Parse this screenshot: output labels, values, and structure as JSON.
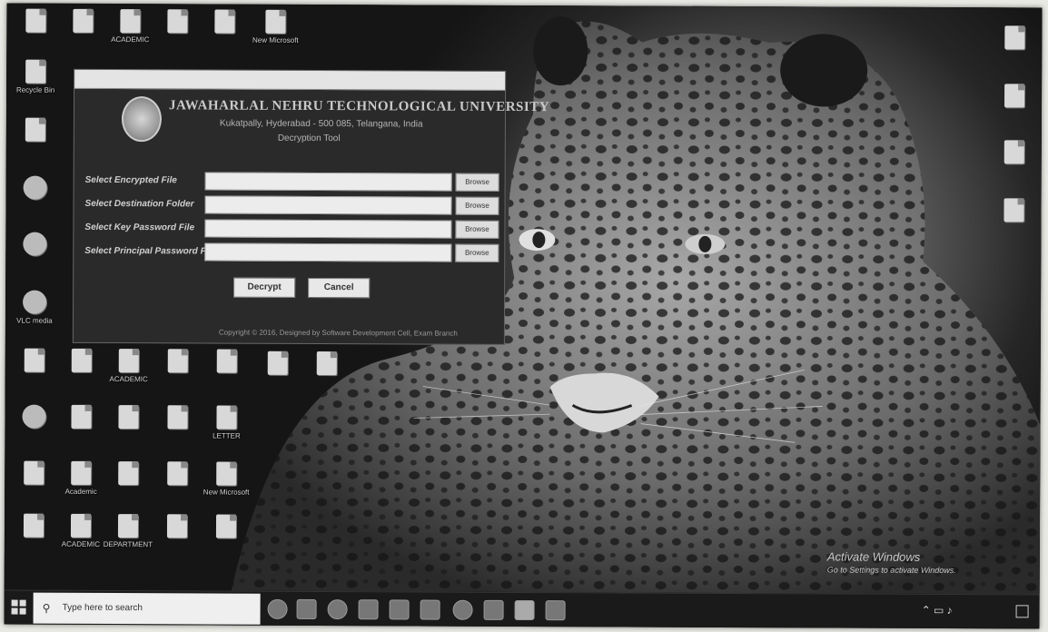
{
  "desktop": {
    "icons": [
      {
        "id": "i1",
        "label": "",
        "shape": "doc"
      },
      {
        "id": "i2",
        "label": "",
        "shape": "doc"
      },
      {
        "id": "i3",
        "label": "ACADEMIC",
        "shape": "doc"
      },
      {
        "id": "i4",
        "label": "",
        "shape": "doc"
      },
      {
        "id": "i5",
        "label": "",
        "shape": "doc"
      },
      {
        "id": "i6",
        "label": "New Microsoft",
        "shape": "doc"
      },
      {
        "id": "i7",
        "label": "Recycle Bin",
        "shape": "doc"
      },
      {
        "id": "i8",
        "label": "",
        "shape": "doc"
      },
      {
        "id": "i9",
        "label": "",
        "shape": "round"
      },
      {
        "id": "i10",
        "label": "",
        "shape": "round"
      },
      {
        "id": "i11",
        "label": "VLC media",
        "shape": "round"
      },
      {
        "id": "i12",
        "label": "",
        "shape": "doc"
      },
      {
        "id": "i13",
        "label": "ACADEMIC",
        "shape": "doc"
      },
      {
        "id": "i14",
        "label": "",
        "shape": "doc"
      },
      {
        "id": "i15",
        "label": "",
        "shape": "doc"
      },
      {
        "id": "i16",
        "label": "",
        "shape": "doc"
      },
      {
        "id": "i17",
        "label": "LETTER",
        "shape": "doc"
      },
      {
        "id": "i18",
        "label": "",
        "shape": "doc"
      },
      {
        "id": "i19",
        "label": "Academic",
        "shape": "doc"
      },
      {
        "id": "i20",
        "label": "",
        "shape": "doc"
      },
      {
        "id": "i21",
        "label": "",
        "shape": "doc"
      },
      {
        "id": "i22",
        "label": "New Microsoft",
        "shape": "doc"
      },
      {
        "id": "i23",
        "label": "",
        "shape": "doc"
      },
      {
        "id": "i24",
        "label": "ACADEMIC",
        "shape": "doc"
      },
      {
        "id": "i25",
        "label": "DEPARTMENT",
        "shape": "doc"
      },
      {
        "id": "i26",
        "label": "",
        "shape": "doc"
      },
      {
        "id": "i27",
        "label": "",
        "shape": "doc"
      },
      {
        "id": "i28",
        "label": "",
        "shape": "doc"
      },
      {
        "id": "i29",
        "label": "",
        "shape": "doc"
      },
      {
        "id": "i30",
        "label": "",
        "shape": "doc"
      },
      {
        "id": "i31",
        "label": "",
        "shape": "doc"
      },
      {
        "id": "i32",
        "label": "",
        "shape": "round"
      },
      {
        "id": "i33",
        "label": "",
        "shape": "doc"
      },
      {
        "id": "i34",
        "label": "",
        "shape": "doc"
      },
      {
        "id": "i35",
        "label": "",
        "shape": "doc"
      },
      {
        "id": "i36",
        "label": "",
        "shape": "doc"
      }
    ]
  },
  "app": {
    "title": "JAWAHARLAL NEHRU TECHNOLOGICAL UNIVERSITY",
    "subtitle": "Kukatpally, Hyderabad - 500 085, Telangana, India",
    "subtitle2": "Decryption Tool",
    "rows": [
      {
        "label": "Select Encrypted File",
        "value": "",
        "browse": "Browse"
      },
      {
        "label": "Select Destination Folder",
        "value": "",
        "browse": "Browse"
      },
      {
        "label": "Select Key Password File",
        "value": "",
        "browse": "Browse"
      },
      {
        "label": "Select Principal Password File",
        "value": "",
        "browse": "Browse"
      }
    ],
    "decrypt_label": "Decrypt",
    "cancel_label": "Cancel",
    "copyright": "Copyright © 2016, Designed by Software Development Cell, Exam Branch"
  },
  "watermark": {
    "line1": "Activate Windows",
    "line2": "Go to Settings to activate Windows."
  },
  "taskbar": {
    "search_placeholder": "Type here to search",
    "clock_time": "",
    "clock_date": "",
    "pinned": [
      "cortana-icon",
      "task-view-icon",
      "chrome-icon",
      "app-icon",
      "file-explorer-icon",
      "folder-icon",
      "app-icon-2",
      "app-icon-3",
      "app-icon-4",
      "app-icon-5"
    ]
  },
  "colors": {
    "wallpaper_base": "#151515",
    "window_bg": "#2a2a2a",
    "field_bg": "#ececec",
    "taskbar_bg": "#1a1a1a"
  }
}
